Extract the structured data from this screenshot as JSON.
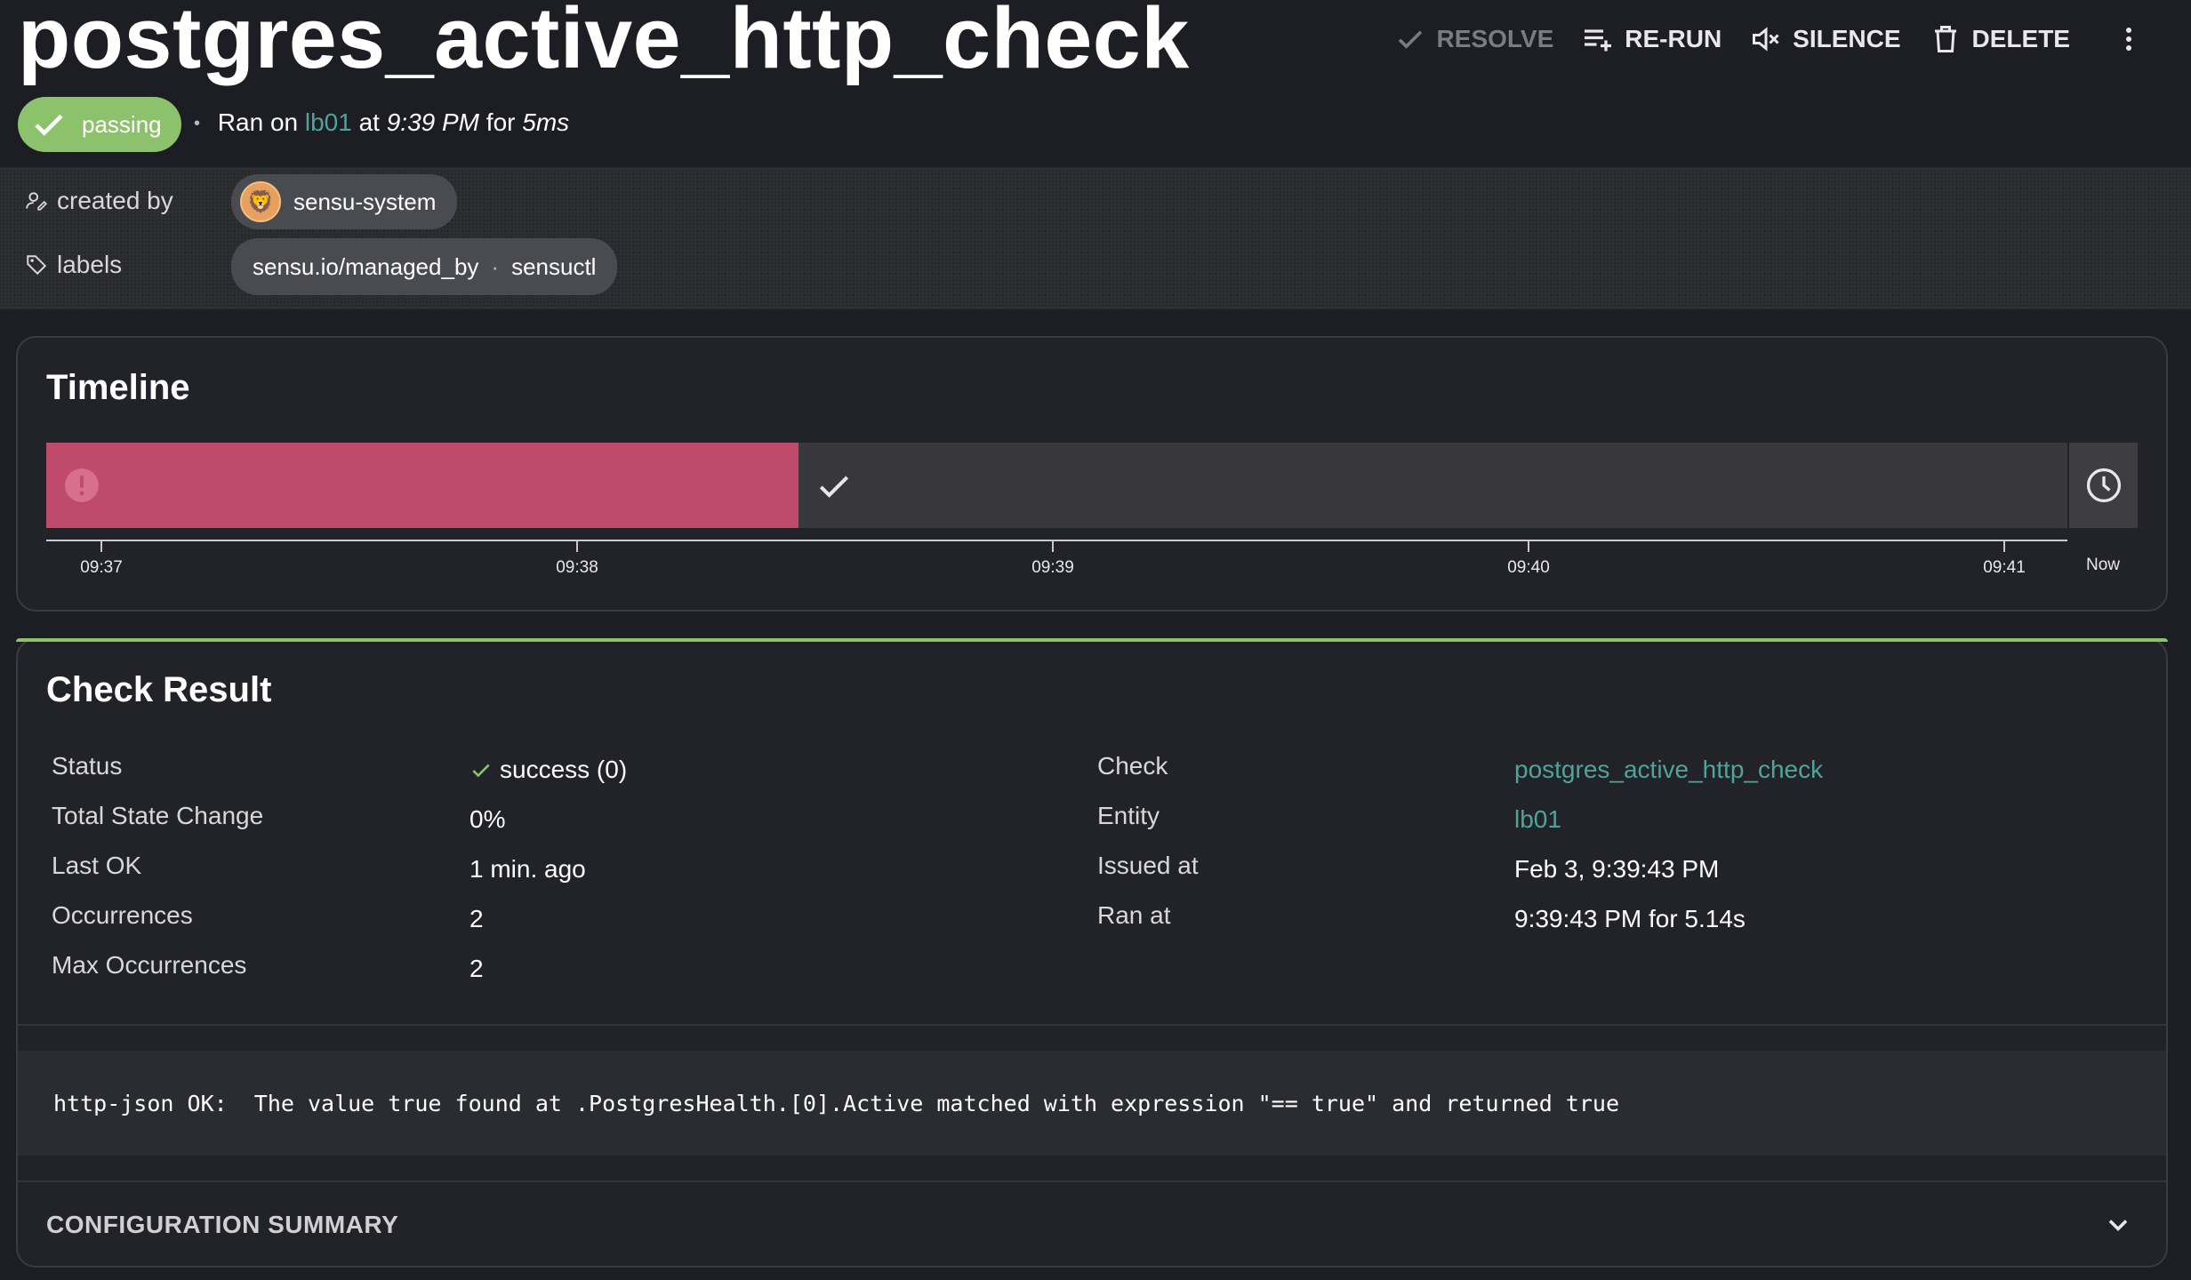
{
  "header": {
    "title": "postgres_active_http_check",
    "actions": {
      "resolve": "RESOLVE",
      "rerun": "RE-RUN",
      "silence": "SILENCE",
      "delete": "DELETE"
    },
    "status_badge": "passing",
    "ran_on_prefix": "Ran on",
    "entity": "lb01",
    "at_word": "at",
    "time": "9:39 PM",
    "for_word": "for",
    "duration": "5ms"
  },
  "meta": {
    "created_by_label": "created by",
    "created_by_value": "sensu-system",
    "labels_label": "labels",
    "label_key": "sensu.io/managed_by",
    "label_sep": "·",
    "label_value": "sensuctl"
  },
  "timeline": {
    "title": "Timeline",
    "ticks": [
      "09:37",
      "09:38",
      "09:39",
      "09:40",
      "09:41"
    ],
    "now_label": "Now",
    "segments": [
      {
        "status": "failing",
        "color": "#bf4a6a"
      },
      {
        "status": "passing",
        "color": "#37373c"
      }
    ]
  },
  "check_result": {
    "title": "Check Result",
    "left": [
      {
        "label": "Status",
        "value": "success (0)"
      },
      {
        "label": "Total State Change",
        "value": "0%"
      },
      {
        "label": "Last OK",
        "value": "1 min. ago"
      },
      {
        "label": "Occurrences",
        "value": "2"
      },
      {
        "label": "Max Occurrences",
        "value": "2"
      }
    ],
    "right": [
      {
        "label": "Check",
        "value": "postgres_active_http_check"
      },
      {
        "label": "Entity",
        "value": "lb01"
      },
      {
        "label": "Issued at",
        "value": "Feb 3, 9:39:43 PM"
      },
      {
        "label": "Ran at",
        "value": "9:39:43 PM for 5.14s"
      }
    ],
    "output": "http-json OK:  The value true found at .PostgresHealth.[0].Active matched with expression \"== true\" and returned true",
    "config_summary": "CONFIGURATION SUMMARY"
  },
  "colors": {
    "accent_green": "#8bc26b",
    "link_teal": "#4fa39a",
    "failing_red": "#bf4a6a",
    "background": "#1d1e23"
  }
}
